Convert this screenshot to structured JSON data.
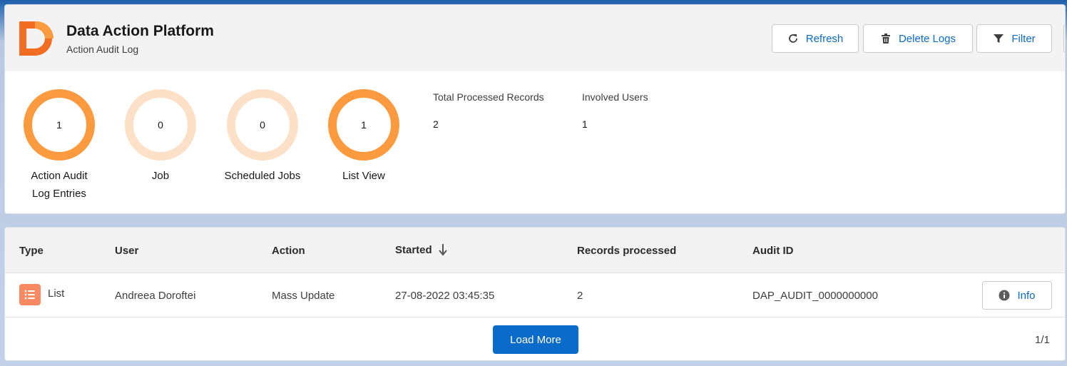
{
  "header": {
    "title": "Data Action Platform",
    "subtitle": "Action Audit Log",
    "buttons": {
      "refresh": "Refresh",
      "delete_logs": "Delete Logs",
      "filter": "Filter"
    },
    "brand_color": "#f26d23"
  },
  "stats": [
    {
      "value": "1",
      "label": "Action Audit Log Entries",
      "active": true
    },
    {
      "value": "0",
      "label": "Job",
      "active": false
    },
    {
      "value": "0",
      "label": "Scheduled Jobs",
      "active": false
    },
    {
      "value": "1",
      "label": "List View",
      "active": true
    }
  ],
  "ring_colors": {
    "active": "#fb9a3e",
    "inactive": "#fde0c8"
  },
  "summary": {
    "total_processed_label": "Total Processed Records",
    "total_processed_value": "2",
    "involved_users_label": "Involved Users",
    "involved_users_value": "1"
  },
  "table": {
    "columns": [
      "Type",
      "User",
      "Action",
      "Started",
      "Records processed",
      "Audit ID"
    ],
    "sorted_column": "Started",
    "rows": [
      {
        "type": "List",
        "type_icon": "list-icon",
        "user": "Andreea Doroftei",
        "action": "Mass Update",
        "started": "27-08-2022 03:45:35",
        "records": "2",
        "audit_id": "DAP_AUDIT_0000000000",
        "info_label": "Info"
      }
    ],
    "load_more": "Load More",
    "pager": "1/1"
  }
}
